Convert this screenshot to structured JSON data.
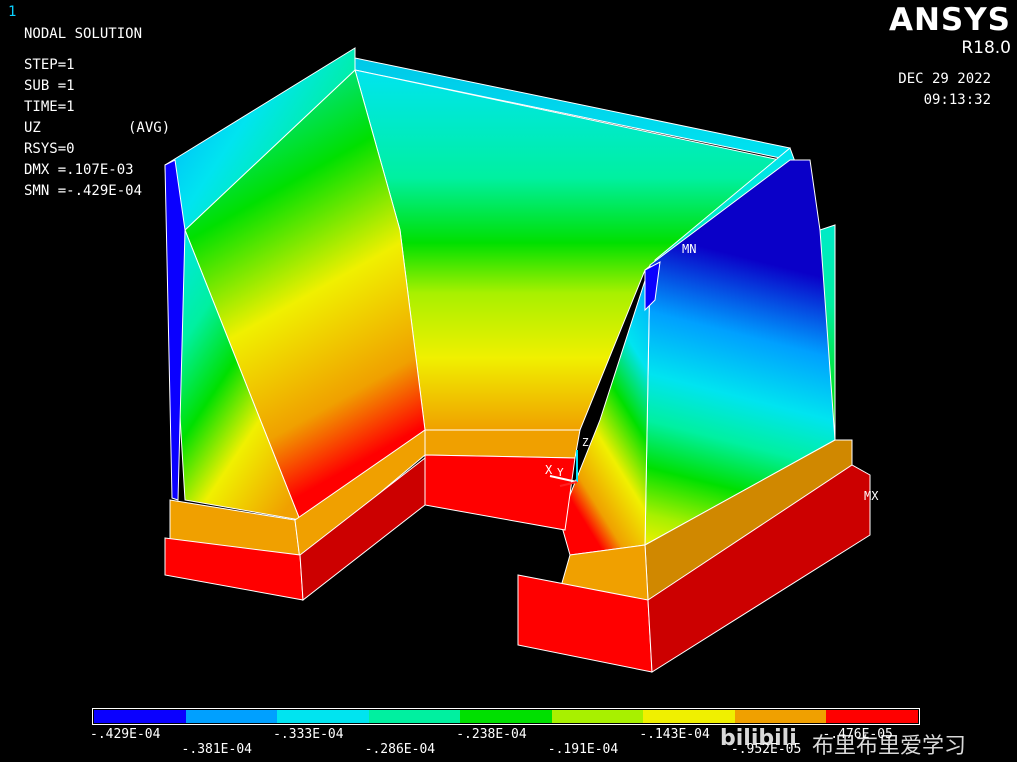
{
  "window": {
    "number": "1"
  },
  "header": {
    "title": "NODAL SOLUTION",
    "step": "STEP=1",
    "sub": "SUB =1",
    "time": "TIME=1",
    "item": "UZ",
    "avg": "(AVG)",
    "rsys": "RSYS=0",
    "dmx": "DMX =.107E-03",
    "smn": "SMN =-.429E-04"
  },
  "brand": {
    "logo": "ANSYS",
    "release": "R18.0"
  },
  "timestamp": {
    "date": "DEC 29 2022",
    "time": "09:13:32"
  },
  "labels": {
    "mn": "MN",
    "mx": "MX",
    "triad_x": "X",
    "triad_y": "Y",
    "triad_z": "Z"
  },
  "legend": {
    "colors": [
      "#0a00ff",
      "#00a0ff",
      "#00e4f0",
      "#00f0a0",
      "#00e000",
      "#a8f000",
      "#f0f000",
      "#f0a000",
      "#ff0000"
    ],
    "top_ticks": [
      "-.429E-04",
      "-.333E-04",
      "-.238E-04",
      "-.143E-04",
      "-.476E-05"
    ],
    "bottom_ticks": [
      "-.381E-04",
      "-.286E-04",
      "-.191E-04",
      "-.952E-05"
    ]
  },
  "watermark": {
    "text": "布里布里爱学习"
  }
}
